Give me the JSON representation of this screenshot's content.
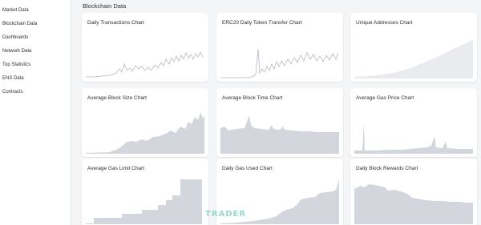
{
  "sidebar": {
    "items": [
      {
        "label": "Market Data"
      },
      {
        "label": "Blockchain Data"
      },
      {
        "label": "Dashboards"
      },
      {
        "label": "Network Data"
      },
      {
        "label": "Top Statistics"
      },
      {
        "label": "ENS Data"
      },
      {
        "label": "Contracts"
      }
    ]
  },
  "main": {
    "section_title": "Blockchain Data",
    "cards": [
      {
        "title": "Daily Transactions Chart",
        "style": "line"
      },
      {
        "title": "ERC20 Daily Token Transfer Chart",
        "style": "line"
      },
      {
        "title": "Unique Addresses Chart",
        "style": "area"
      },
      {
        "title": "Average Block Size Chart",
        "style": "area"
      },
      {
        "title": "Average Block Time Chart",
        "style": "area"
      },
      {
        "title": "Average Gas Price Chart",
        "style": "area"
      },
      {
        "title": "Average Gas Limit Chart",
        "style": "area"
      },
      {
        "title": "Daily Gas Used Chart",
        "style": "area"
      },
      {
        "title": "Daily Block Rewards Chart",
        "style": "area"
      }
    ]
  },
  "colors": {
    "line": "#b4b9c2",
    "area_fill": "#d3d6dc",
    "area_light": "#e9ebef"
  },
  "watermark": {
    "text": "TRADER"
  }
}
